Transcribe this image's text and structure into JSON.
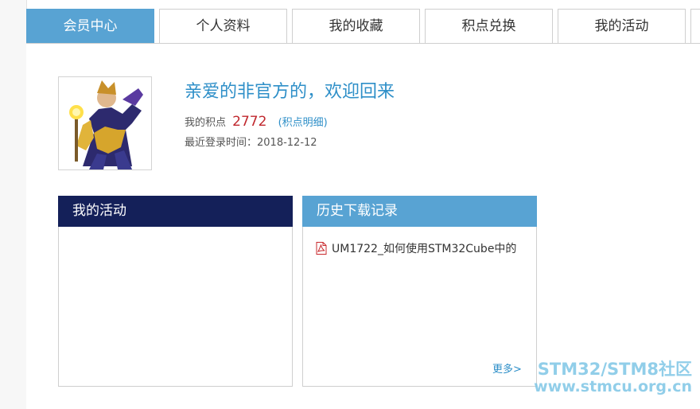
{
  "tabs": [
    {
      "label": "会员中心",
      "active": true
    },
    {
      "label": "个人资料",
      "active": false
    },
    {
      "label": "我的收藏",
      "active": false
    },
    {
      "label": "积点兑换",
      "active": false
    },
    {
      "label": "我的活动",
      "active": false
    }
  ],
  "profile": {
    "welcome": "亲爱的非官方的，欢迎回来",
    "points_label": "我的积点",
    "points_value": "2772",
    "points_detail": "积点明细",
    "paren_open": "(",
    "paren_close": ")",
    "last_login": "最近登录时间：2018-12-12"
  },
  "activity_panel": {
    "title": "我的活动"
  },
  "downloads_panel": {
    "title": "历史下载记录",
    "items": [
      {
        "name": "UM1722_如何使用STM32Cube中的",
        "icon": "pdf-icon"
      }
    ],
    "more": "更多>"
  },
  "watermark": {
    "line1": "STM32/STM8社区",
    "line2": "www.stmcu.org.cn"
  },
  "colors": {
    "active_tab": "#58a3d3",
    "activity_header": "#142059",
    "download_header": "#58a3d3",
    "link_blue": "#2e8fc8",
    "points_red": "#c0272d"
  }
}
